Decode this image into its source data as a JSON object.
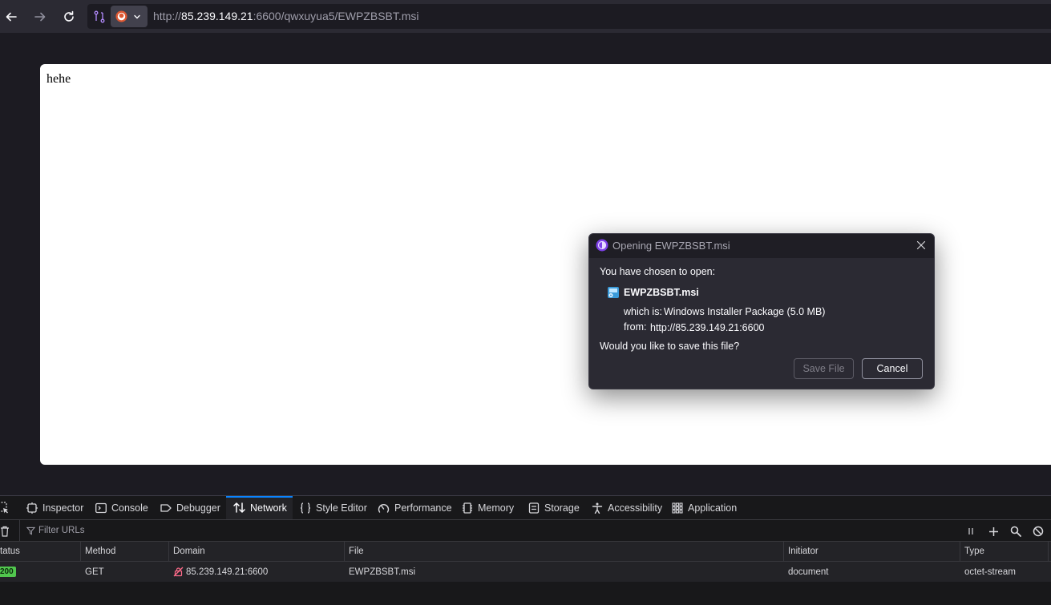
{
  "browser": {
    "url_scheme": "http://",
    "url_host": "85.239.149.21",
    "url_rest": ":6600/qwxuyua5/EWPZBSBT.msi"
  },
  "page": {
    "body_text": "hehe"
  },
  "dialog": {
    "title": "Opening EWPZBSBT.msi",
    "intro": "You have chosen to open:",
    "filename": "EWPZBSBT.msi",
    "which_is_label": "which is:",
    "which_is_value": "Windows Installer Package (5.0 MB)",
    "from_label": "from:",
    "from_value": "http://85.239.149.21:6600",
    "question": "Would you like to save this file?",
    "save_label": "Save File",
    "cancel_label": "Cancel"
  },
  "devtools": {
    "tabs": [
      {
        "label": "Inspector",
        "icon": "inspector-icon"
      },
      {
        "label": "Console",
        "icon": "console-icon"
      },
      {
        "label": "Debugger",
        "icon": "debugger-icon"
      },
      {
        "label": "Network",
        "icon": "network-icon",
        "active": true
      },
      {
        "label": "Style Editor",
        "icon": "style-editor-icon"
      },
      {
        "label": "Performance",
        "icon": "performance-icon"
      },
      {
        "label": "Memory",
        "icon": "memory-icon"
      },
      {
        "label": "Storage",
        "icon": "storage-icon"
      },
      {
        "label": "Accessibility",
        "icon": "accessibility-icon"
      },
      {
        "label": "Application",
        "icon": "application-icon"
      }
    ],
    "filter_placeholder": "Filter URLs",
    "columns": [
      "tatus",
      "Method",
      "Domain",
      "File",
      "Initiator",
      "Type"
    ],
    "rows": [
      {
        "status": "200",
        "method": "GET",
        "domain": "85.239.149.21:6600",
        "file": "EWPZBSBT.msi",
        "initiator": "document",
        "type": "octet-stream"
      }
    ],
    "accent_color": "#0a84ff",
    "status_ok_color": "#51c74e"
  }
}
